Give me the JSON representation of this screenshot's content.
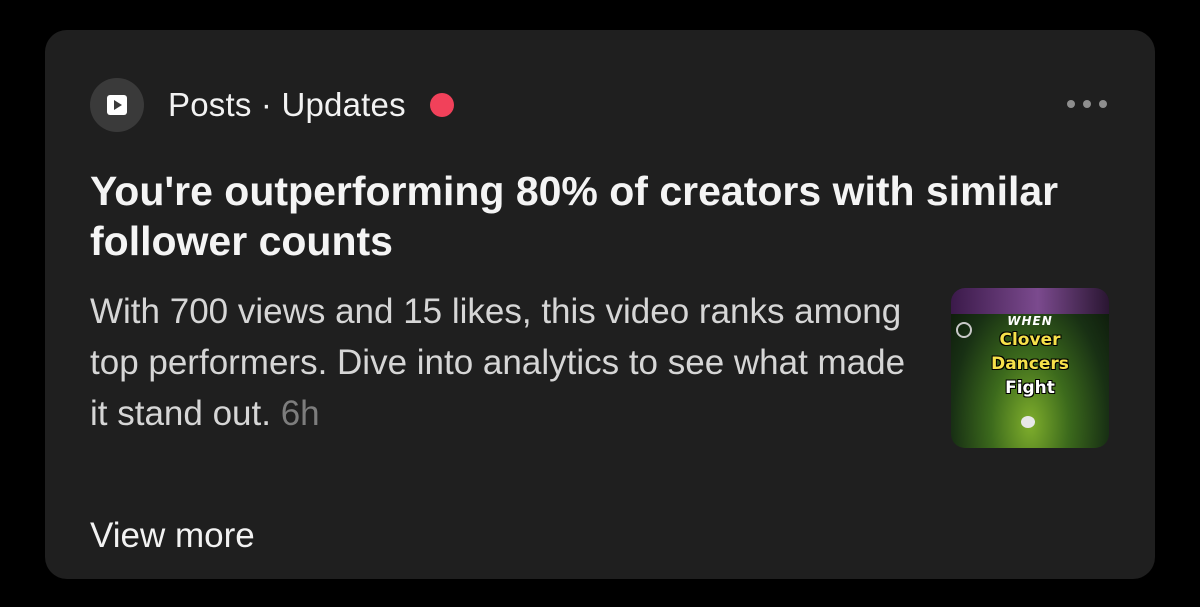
{
  "notification": {
    "category_label": "Posts · Updates",
    "title": "You're outperforming 80% of creators with similar follower counts",
    "body": "With 700 views and 15 likes, this video ranks among top performers. Dive into analytics to see what made it stand out.",
    "timestamp": "6h",
    "view_more_label": "View more",
    "unread": true,
    "thumbnail": {
      "line1": "WHEN",
      "line2": "Clover",
      "line3": "Dancers",
      "line4": "Fight"
    }
  },
  "icons": {
    "app": "play-square-icon",
    "more": "more-horizontal-icon",
    "unread": "unread-dot"
  },
  "colors": {
    "background": "#000000",
    "card": "#1f1f1f",
    "unread_dot": "#f1415a",
    "timestamp": "#7d7d7d"
  }
}
